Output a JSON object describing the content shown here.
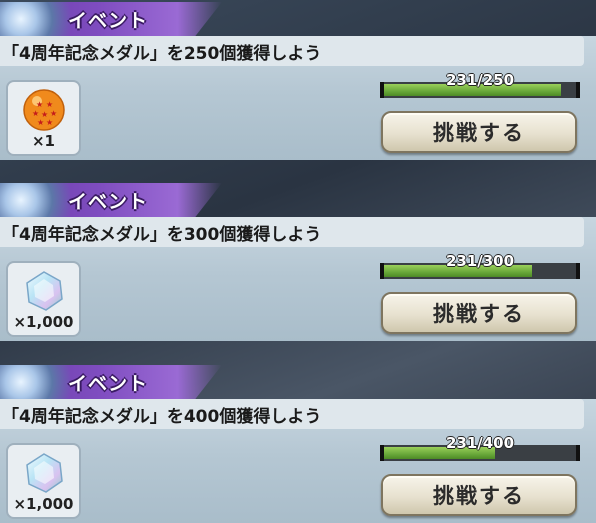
{
  "missions": [
    {
      "tag": "イベント",
      "title": "「4周年記念メダル」を250個獲得しよう",
      "reward": {
        "icon": "dragon-ball-icon",
        "quantity": "×1"
      },
      "progress": {
        "text": "231/250",
        "current": 231,
        "goal": 250
      },
      "button_label": "挑戦する"
    },
    {
      "tag": "イベント",
      "title": "「4周年記念メダル」を300個獲得しよう",
      "reward": {
        "icon": "dragon-stone-icon",
        "quantity": "×1,000"
      },
      "progress": {
        "text": "231/300",
        "current": 231,
        "goal": 300
      },
      "button_label": "挑戦する"
    },
    {
      "tag": "イベント",
      "title": "「4周年記念メダル」を400個獲得しよう",
      "reward": {
        "icon": "dragon-stone-icon",
        "quantity": "×1,000"
      },
      "progress": {
        "text": "231/400",
        "current": 231,
        "goal": 400
      },
      "button_label": "挑戦する"
    }
  ],
  "colors": {
    "tag_purple": "#7f4dc0",
    "progress_green": "#69a83a",
    "panel_blue": "#b5c7d3"
  }
}
